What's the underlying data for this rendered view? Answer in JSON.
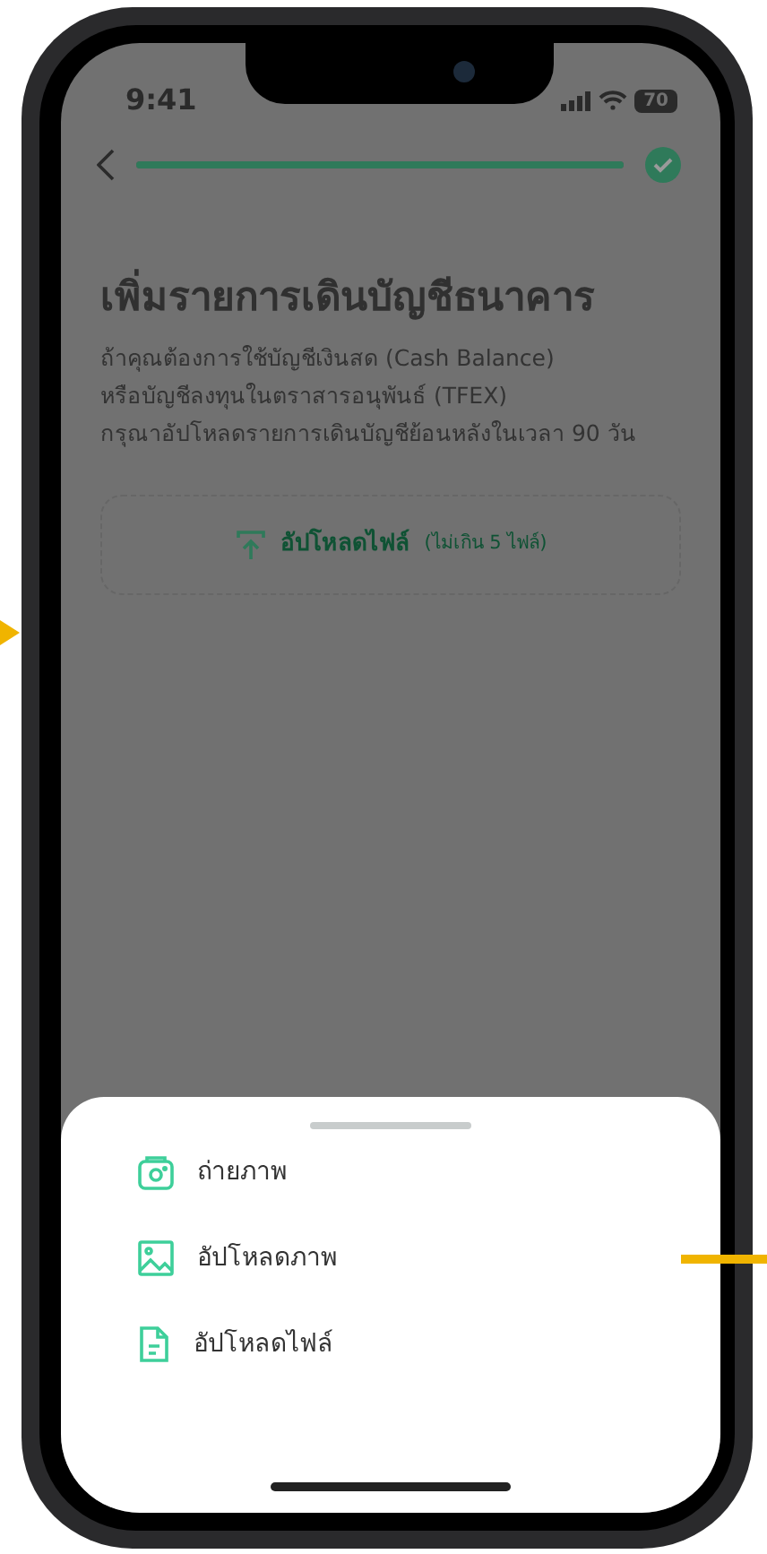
{
  "status_bar": {
    "time": "9:41",
    "battery": "70"
  },
  "progress": {
    "level": 1
  },
  "title": "เพิ่มรายการเดินบัญชีธนาคาร",
  "description": [
    "ถ้าคุณต้องการใช้บัญชีเงินสด (Cash Balance)",
    "หรือบัญชีลงทุนในตราสารอนุพันธ์ (TFEX)",
    "กรุณาอัปโหลดรายการเดินบัญชีย้อนหลังในเวลา 90 วัน"
  ],
  "upload": {
    "label": "อัปโหลดไฟล์",
    "note": "(ไม่เกิน 5 ไฟล์)"
  },
  "sheet": {
    "options": [
      {
        "kind": "camera",
        "label": "ถ่ายภาพ"
      },
      {
        "kind": "image",
        "label": "อัปโหลดภาพ"
      },
      {
        "kind": "file",
        "label": "อัปโหลดไฟล์"
      }
    ]
  }
}
